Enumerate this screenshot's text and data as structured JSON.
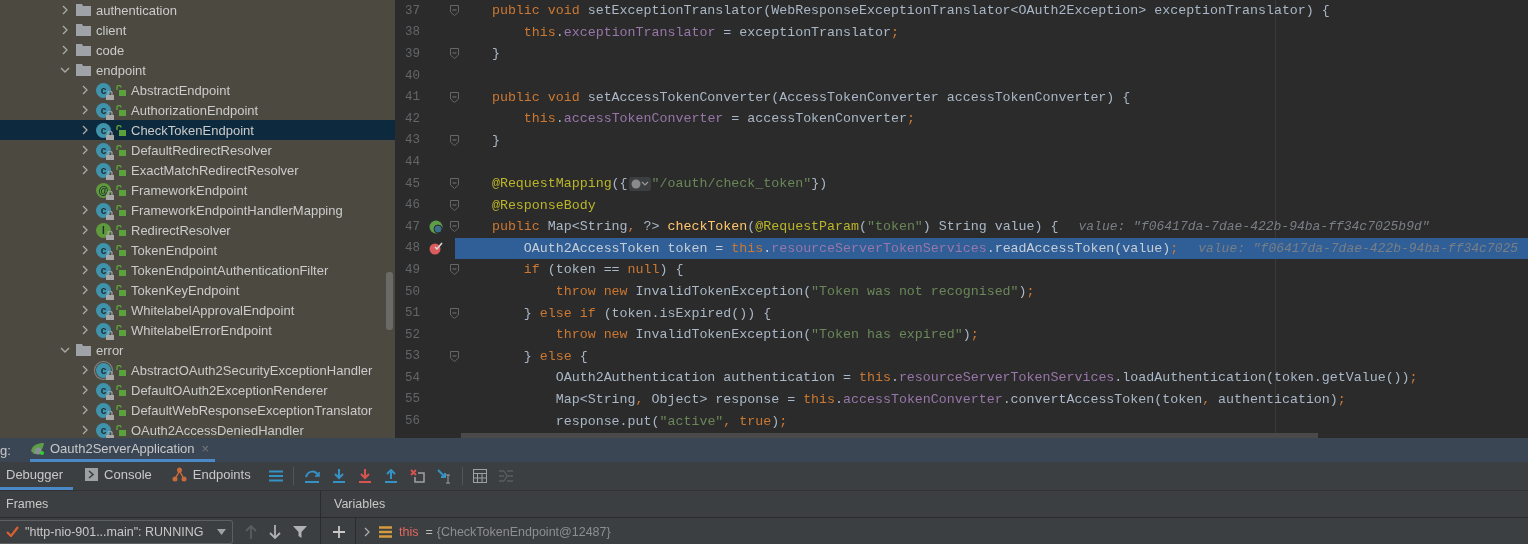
{
  "tree": [
    {
      "kind": "folder",
      "label": "authentication",
      "expanded": false
    },
    {
      "kind": "folder",
      "label": "client",
      "expanded": false
    },
    {
      "kind": "folder",
      "label": "code",
      "expanded": false
    },
    {
      "kind": "folder",
      "label": "endpoint",
      "expanded": true,
      "children": [
        {
          "kind": "class",
          "glyph": "c",
          "label": "AbstractEndpoint",
          "leaf": false,
          "selected": false
        },
        {
          "kind": "class",
          "glyph": "c",
          "label": "AuthorizationEndpoint",
          "leaf": false,
          "selected": false
        },
        {
          "kind": "class",
          "glyph": "c",
          "label": "CheckTokenEndpoint",
          "leaf": false,
          "selected": true
        },
        {
          "kind": "class",
          "glyph": "c",
          "label": "DefaultRedirectResolver",
          "leaf": false,
          "selected": false
        },
        {
          "kind": "class",
          "glyph": "c",
          "label": "ExactMatchRedirectResolver",
          "leaf": false,
          "selected": false
        },
        {
          "kind": "annotation",
          "glyph": "@",
          "label": "FrameworkEndpoint",
          "leaf": true,
          "selected": false
        },
        {
          "kind": "class",
          "glyph": "c",
          "label": "FrameworkEndpointHandlerMapping",
          "leaf": false,
          "selected": false
        },
        {
          "kind": "interface",
          "glyph": "I",
          "label": "RedirectResolver",
          "leaf": false,
          "selected": false
        },
        {
          "kind": "class",
          "glyph": "c",
          "label": "TokenEndpoint",
          "leaf": false,
          "selected": false
        },
        {
          "kind": "class",
          "glyph": "c",
          "label": "TokenEndpointAuthenticationFilter",
          "leaf": false,
          "selected": false
        },
        {
          "kind": "class",
          "glyph": "c",
          "label": "TokenKeyEndpoint",
          "leaf": false,
          "selected": false
        },
        {
          "kind": "class",
          "glyph": "c",
          "label": "WhitelabelApprovalEndpoint",
          "leaf": false,
          "selected": false
        },
        {
          "kind": "class",
          "glyph": "c",
          "label": "WhitelabelErrorEndpoint",
          "leaf": false,
          "selected": false
        }
      ]
    },
    {
      "kind": "folder",
      "label": "error",
      "expanded": true,
      "children": [
        {
          "kind": "abstract",
          "glyph": "c",
          "label": "AbstractOAuth2SecurityExceptionHandler",
          "leaf": false,
          "selected": false
        },
        {
          "kind": "class",
          "glyph": "c",
          "label": "DefaultOAuth2ExceptionRenderer",
          "leaf": false,
          "selected": false
        },
        {
          "kind": "class",
          "glyph": "c",
          "label": "DefaultWebResponseExceptionTranslator",
          "leaf": false,
          "selected": false
        },
        {
          "kind": "class",
          "glyph": "c",
          "label": "OAuth2AccessDeniedHandler",
          "leaf": false,
          "selected": false
        }
      ]
    }
  ],
  "editor": {
    "lines": [
      {
        "number": "37",
        "kind": "code",
        "fold": true,
        "selected": false,
        "tokens": [
          {
            "kind": "kw",
            "text": "    public void"
          },
          {
            "kind": "plain",
            "text": " setExceptionTranslator(WebResponseExceptionTranslator<OAuth2Exception> exceptionTranslator) {"
          }
        ]
      },
      {
        "number": "38",
        "kind": "code",
        "fold": false,
        "selected": false,
        "tokens": [
          {
            "kind": "kw",
            "text": "        this"
          },
          {
            "kind": "plain",
            "text": "."
          },
          {
            "kind": "field",
            "text": "exceptionTranslator"
          },
          {
            "kind": "plain",
            "text": " = exceptionTranslator"
          },
          {
            "kind": "kw",
            "text": ";"
          }
        ]
      },
      {
        "number": "39",
        "kind": "code",
        "fold": true,
        "selected": false,
        "tokens": [
          {
            "kind": "plain",
            "text": "    }"
          }
        ]
      },
      {
        "number": "40",
        "kind": "code",
        "fold": false,
        "selected": false
      },
      {
        "number": "41",
        "kind": "code",
        "fold": true,
        "selected": false,
        "tokens": [
          {
            "kind": "kw",
            "text": "    public void"
          },
          {
            "kind": "plain",
            "text": " setAccessTokenConverter(AccessTokenConverter accessTokenConverter) {"
          }
        ]
      },
      {
        "number": "42",
        "kind": "code",
        "fold": false,
        "selected": false,
        "tokens": [
          {
            "kind": "kw",
            "text": "        this"
          },
          {
            "kind": "plain",
            "text": "."
          },
          {
            "kind": "field",
            "text": "accessTokenConverter"
          },
          {
            "kind": "plain",
            "text": " = accessTokenConverter"
          },
          {
            "kind": "kw",
            "text": ";"
          }
        ]
      },
      {
        "number": "43",
        "kind": "code",
        "fold": true,
        "selected": false,
        "tokens": [
          {
            "kind": "plain",
            "text": "    }"
          }
        ]
      },
      {
        "number": "44",
        "kind": "code",
        "fold": false,
        "selected": false
      },
      {
        "number": "45",
        "kind": "code",
        "fold": true,
        "selected": false,
        "tokens": [
          {
            "kind": "ann",
            "text": "    @RequestMapping"
          },
          {
            "kind": "plain",
            "text": "({"
          },
          {
            "kind": "chip"
          },
          {
            "kind": "str",
            "text": "\"/oauth/check_token\""
          },
          {
            "kind": "plain",
            "text": "})"
          }
        ]
      },
      {
        "number": "46",
        "kind": "code",
        "fold": true,
        "selected": false,
        "tokens": [
          {
            "kind": "ann",
            "text": "    @ResponseBody"
          }
        ]
      },
      {
        "number": "47",
        "fold": true,
        "selected": false,
        "kind": "endpoint",
        "tokens": [
          {
            "kind": "kw",
            "text": "    public"
          },
          {
            "kind": "plain",
            "text": " Map<String"
          },
          {
            "kind": "kw",
            "text": ","
          },
          {
            "kind": "plain",
            "text": " ?> "
          },
          {
            "kind": "method",
            "text": "checkToken"
          },
          {
            "kind": "plain",
            "text": "("
          },
          {
            "kind": "ann",
            "text": "@RequestParam"
          },
          {
            "kind": "plain",
            "text": "("
          },
          {
            "kind": "str",
            "text": "\"token\""
          },
          {
            "kind": "plain",
            "text": ") String value) {"
          },
          {
            "kind": "hint",
            "text": "value: \"f06417da-7dae-422b-94ba-ff34c7025b9d\""
          }
        ]
      },
      {
        "number": "48",
        "fold": false,
        "selected": true,
        "kind": "breakpoint",
        "tokens": [
          {
            "kind": "plain",
            "text": "        OAuth2AccessToken token = "
          },
          {
            "kind": "kw",
            "text": "this"
          },
          {
            "kind": "plain",
            "text": "."
          },
          {
            "kind": "field",
            "text": "resourceServerTokenServices"
          },
          {
            "kind": "plain",
            "text": ".readAccessToken(value)"
          },
          {
            "kind": "kw",
            "text": ";"
          },
          {
            "kind": "hint",
            "text": "value: \"f06417da-7dae-422b-94ba-ff34c7025"
          }
        ]
      },
      {
        "number": "49",
        "kind": "code",
        "fold": true,
        "selected": false,
        "tokens": [
          {
            "kind": "kw",
            "text": "        if"
          },
          {
            "kind": "plain",
            "text": " (token == "
          },
          {
            "kind": "kw",
            "text": "null"
          },
          {
            "kind": "plain",
            "text": ") {"
          }
        ]
      },
      {
        "number": "50",
        "kind": "code",
        "fold": false,
        "selected": false,
        "tokens": [
          {
            "kind": "kw",
            "text": "            throw new"
          },
          {
            "kind": "plain",
            "text": " InvalidTokenException("
          },
          {
            "kind": "str",
            "text": "\"Token was not recognised\""
          },
          {
            "kind": "plain",
            "text": ")"
          },
          {
            "kind": "kw",
            "text": ";"
          }
        ]
      },
      {
        "number": "51",
        "kind": "code",
        "fold": true,
        "selected": false,
        "tokens": [
          {
            "kind": "plain",
            "text": "        } "
          },
          {
            "kind": "kw",
            "text": "else if"
          },
          {
            "kind": "plain",
            "text": " (token.isExpired()) {"
          }
        ]
      },
      {
        "number": "52",
        "kind": "code",
        "fold": false,
        "selected": false,
        "tokens": [
          {
            "kind": "kw",
            "text": "            throw new"
          },
          {
            "kind": "plain",
            "text": " InvalidTokenException("
          },
          {
            "kind": "str",
            "text": "\"Token has expired\""
          },
          {
            "kind": "plain",
            "text": ")"
          },
          {
            "kind": "kw",
            "text": ";"
          }
        ]
      },
      {
        "number": "53",
        "kind": "code",
        "fold": true,
        "selected": false,
        "tokens": [
          {
            "kind": "plain",
            "text": "        } "
          },
          {
            "kind": "kw",
            "text": "else"
          },
          {
            "kind": "plain",
            "text": " {"
          }
        ]
      },
      {
        "number": "54",
        "kind": "code",
        "fold": false,
        "selected": false,
        "tokens": [
          {
            "kind": "plain",
            "text": "            OAuth2Authentication authentication = "
          },
          {
            "kind": "kw",
            "text": "this"
          },
          {
            "kind": "plain",
            "text": "."
          },
          {
            "kind": "field",
            "text": "resourceServerTokenServices"
          },
          {
            "kind": "plain",
            "text": ".loadAuthentication(token.getValue())"
          },
          {
            "kind": "kw",
            "text": ";"
          }
        ]
      },
      {
        "number": "55",
        "kind": "code",
        "fold": false,
        "selected": false,
        "tokens": [
          {
            "kind": "plain",
            "text": "            Map<String"
          },
          {
            "kind": "kw",
            "text": ","
          },
          {
            "kind": "plain",
            "text": " Object> response = "
          },
          {
            "kind": "kw",
            "text": "this"
          },
          {
            "kind": "plain",
            "text": "."
          },
          {
            "kind": "field",
            "text": "accessTokenConverter"
          },
          {
            "kind": "plain",
            "text": ".convertAccessToken(token"
          },
          {
            "kind": "kw",
            "text": ","
          },
          {
            "kind": "plain",
            "text": " authentication)"
          },
          {
            "kind": "kw",
            "text": ";"
          }
        ]
      },
      {
        "number": "56",
        "kind": "code",
        "fold": false,
        "selected": false,
        "tokens": [
          {
            "kind": "plain",
            "text": "            response.put("
          },
          {
            "kind": "str",
            "text": "\"active\""
          },
          {
            "kind": "kw",
            "text": ", true"
          },
          {
            "kind": "plain",
            "text": ")"
          },
          {
            "kind": "kw",
            "text": ";"
          }
        ]
      }
    ]
  },
  "debug": {
    "label": "g:",
    "tabs": [
      {
        "label": "Oauth2ServerApplication",
        "close": "×",
        "selected": true
      }
    ],
    "toolbar_tabs": [
      {
        "kind": "debugger",
        "label": "Debugger",
        "selected": true
      },
      {
        "kind": "console",
        "label": "Console",
        "selected": false
      },
      {
        "kind": "endpoints",
        "label": "Endpoints",
        "selected": false
      }
    ],
    "frames": {
      "title": "Frames",
      "thread": "\"http-nio-901...main\": RUNNING"
    },
    "variables": {
      "title": "Variables",
      "rows": [
        {
          "name": "this",
          "separator": "=",
          "value": "{CheckTokenEndpoint@12487}",
          "expanded": false
        }
      ]
    }
  }
}
